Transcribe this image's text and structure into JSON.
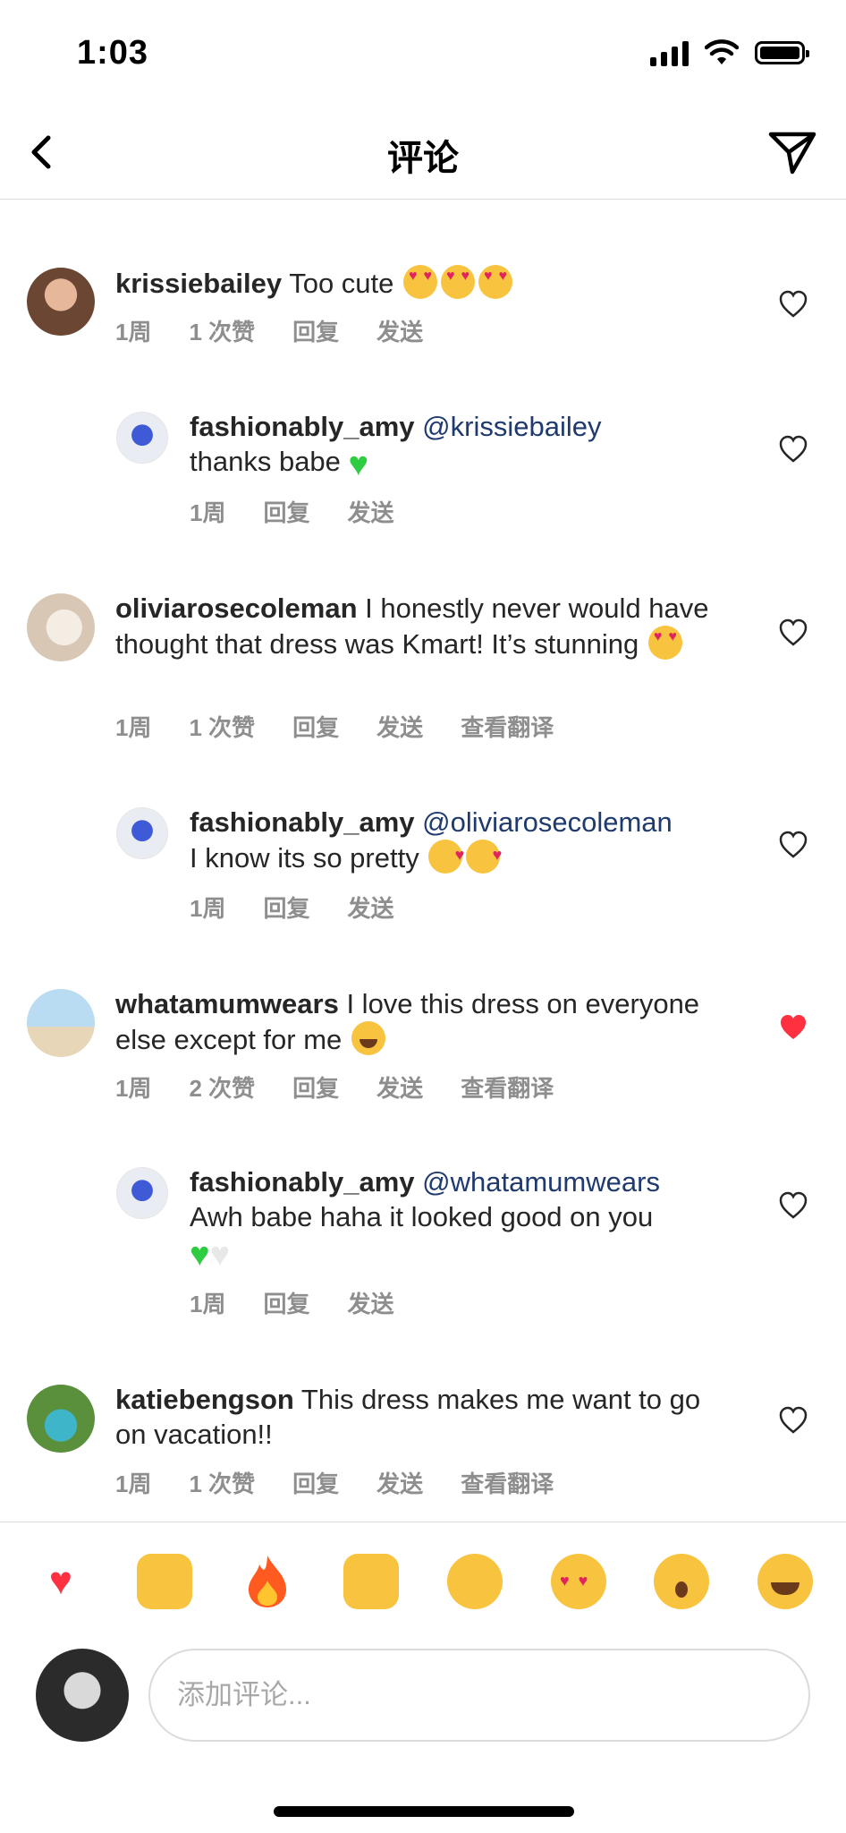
{
  "status_bar": {
    "time": "1:03"
  },
  "header": {
    "title": "评论"
  },
  "comments": [
    {
      "username": "krissiebailey",
      "text": "Too cute",
      "emoji": [
        "heart-eyes",
        "heart-eyes",
        "heart-eyes"
      ],
      "meta": {
        "time": "1周",
        "likes": "1 次赞",
        "reply": "回复",
        "send": "发送"
      },
      "liked": false
    },
    {
      "username": "fashionably_amy",
      "mention": "@krissiebailey",
      "text": "thanks babe",
      "emoji": [
        "green-heart"
      ],
      "meta": {
        "time": "1周",
        "reply": "回复",
        "send": "发送"
      },
      "liked": false
    },
    {
      "username": "oliviarosecoleman",
      "text": "I honestly never would have thought that dress was Kmart! It’s stunning",
      "emoji": [
        "heart-eyes"
      ],
      "meta": {
        "time": "1周",
        "likes": "1 次赞",
        "reply": "回复",
        "send": "发送",
        "translate": "查看翻译"
      },
      "liked": false
    },
    {
      "username": "fashionably_amy",
      "mention": "@oliviarosecoleman",
      "text": "I know its so pretty",
      "emoji": [
        "smiling-face-with-hearts",
        "smiling-face-with-hearts"
      ],
      "meta": {
        "time": "1周",
        "reply": "回复",
        "send": "发送"
      },
      "liked": false
    },
    {
      "username": "whatamumwears",
      "text": "I love this dress on everyone else except for me",
      "emoji": [
        "tears-of-joy"
      ],
      "meta": {
        "time": "1周",
        "likes": "2 次赞",
        "reply": "回复",
        "send": "发送",
        "translate": "查看翻译"
      },
      "liked": true
    },
    {
      "username": "fashionably_amy",
      "mention": "@whatamumwears",
      "text": "Awh babe haha it looked good on you",
      "emoji": [
        "green-heart",
        "white-heart"
      ],
      "meta": {
        "time": "1周",
        "reply": "回复",
        "send": "发送"
      },
      "liked": false
    },
    {
      "username": "katiebengson",
      "text": "This dress makes me want to go on vacation!!",
      "meta": {
        "time": "1周",
        "likes": "1 次赞",
        "reply": "回复",
        "send": "发送",
        "translate": "查看翻译"
      },
      "liked": false
    }
  ],
  "reactions": [
    "red-heart",
    "raising-hands",
    "fire",
    "clapping-hands",
    "crying-face",
    "heart-eyes",
    "surprised-face",
    "tears-of-joy"
  ],
  "input": {
    "placeholder": "添加评论..."
  },
  "colors": {
    "like_red": "#ff3040",
    "mention_blue": "#1e3a6f",
    "meta_gray": "#8e8e8e"
  }
}
